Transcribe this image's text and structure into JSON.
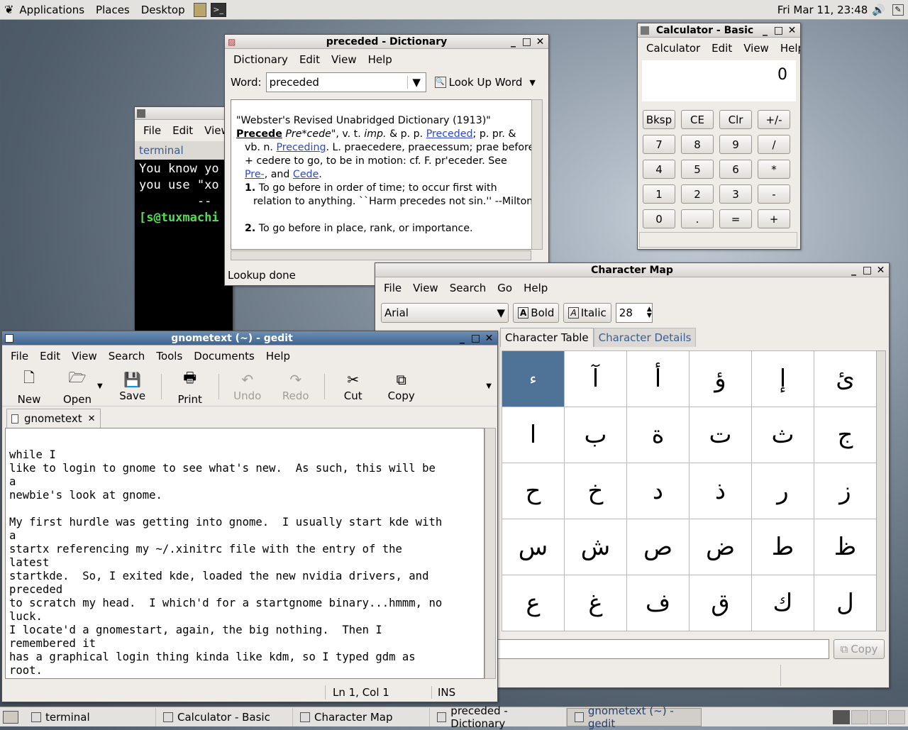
{
  "top_panel": {
    "menus": [
      "Applications",
      "Places",
      "Desktop"
    ],
    "clock": "Fri Mar 11, 23:48"
  },
  "terminal": {
    "menus": [
      "File",
      "Edit",
      "View"
    ],
    "tab": "terminal",
    "lines": [
      "You know yo",
      "you use \"xo",
      "        --"
    ],
    "prompt": "[s@tuxmachi"
  },
  "dictionary": {
    "title": "preceded - Dictionary",
    "menus": [
      "Dictionary",
      "Edit",
      "View",
      "Help"
    ],
    "word_label": "Word:",
    "word_value": "preceded",
    "lookup_label": "Look Up Word",
    "source": "\"Webster's Revised Unabridged Dictionary (1913)\"",
    "headword": "Precede",
    "pron": "Pre*cede\"",
    "def_line1_a": ", v. t.",
    "def_line1_b": "imp.",
    "def_line1_c": "& p. p.",
    "link_preceded": "Preceded",
    "def_line1_d": "; p. pr. &",
    "def_line2_a": "vb. n.",
    "link_preceding": "Preceding",
    "def_line2_b": ". L. praecedere, praecessum; prae before",
    "def_line3": "+ cedere to go, to be in motion: cf. F. pr'eceder. See",
    "link_pre": "Pre-",
    "def_line4_a": ", and",
    "link_cede": "Cede",
    "def_line4_b": ".",
    "sense1_num": "1.",
    "sense1_a": "To go before in order of time; to occur first with",
    "sense1_b": "relation to anything. ``Harm precedes not sin.'' --Milton.",
    "sense2_num": "2.",
    "sense2": "To go before in place, rank, or importance.",
    "status": "Lookup done"
  },
  "calculator": {
    "title": "Calculator - Basic",
    "menus": [
      "Calculator",
      "Edit",
      "View",
      "Help"
    ],
    "display": "0",
    "rows": [
      [
        "Bksp",
        "CE",
        "Clr",
        "+/-"
      ],
      [
        "7",
        "8",
        "9",
        "/"
      ],
      [
        "4",
        "5",
        "6",
        "*"
      ],
      [
        "1",
        "2",
        "3",
        "-"
      ],
      [
        "0",
        ".",
        "=",
        "+"
      ]
    ]
  },
  "charmap": {
    "title": "Character Map",
    "menus": [
      "File",
      "View",
      "Search",
      "Go",
      "Help"
    ],
    "font": "Arial",
    "bold_label": "Bold",
    "italic_label": "Italic",
    "size": "28",
    "tab_table": "Character Table",
    "tab_details": "Character Details",
    "chars": [
      [
        "ء",
        "آ",
        "أ",
        "ؤ",
        "إ",
        "ئ"
      ],
      [
        "ا",
        "ب",
        "ة",
        "ت",
        "ث",
        "ج"
      ],
      [
        "ح",
        "خ",
        "د",
        "ذ",
        "ر",
        "ز"
      ],
      [
        "س",
        "ش",
        "ص",
        "ض",
        "ط",
        "ظ"
      ],
      [
        "ع",
        "غ",
        "ف",
        "ق",
        "ك",
        "ل"
      ]
    ],
    "copy_label": "Copy"
  },
  "gedit": {
    "title": "gnometext (~) - gedit",
    "menus": [
      "File",
      "Edit",
      "View",
      "Search",
      "Tools",
      "Documents",
      "Help"
    ],
    "toolbar": [
      {
        "label": "New",
        "icon": "new-document-icon",
        "enabled": true
      },
      {
        "label": "Open",
        "icon": "open-folder-icon",
        "enabled": true
      },
      {
        "label": "Save",
        "icon": "save-icon",
        "enabled": true
      },
      {
        "label": "Print",
        "icon": "print-icon",
        "enabled": true
      },
      {
        "label": "Undo",
        "icon": "undo-icon",
        "enabled": false
      },
      {
        "label": "Redo",
        "icon": "redo-icon",
        "enabled": false
      },
      {
        "label": "Cut",
        "icon": "cut-icon",
        "enabled": true
      },
      {
        "label": "Copy",
        "icon": "copy-icon",
        "enabled": true
      }
    ],
    "tab": "gnometext",
    "text": "while I\nlike to login to gnome to see what's new.  As such, this will be\na\nnewbie's look at gnome.\n\nMy first hurdle was getting into gnome.  I usually start kde with\na\nstartx referencing my ~/.xinitrc file with the entry of the\nlatest\nstartkde.  So, I exited kde, loaded the new nvidia drivers, and\npreceded\nto scratch my head.  I which'd for a startgnome binary...hmmm, no\nluck.\nI locate'd a gnomestart, again, the big nothing.  Then I\nremembered it\nhas a graphical login thing kinda like kdm, so I typed gdm as\nroot.\nAhhh, there we go.  I logged in and chose gnome as the session.",
    "position": "Ln 1, Col 1",
    "mode": "INS"
  },
  "taskbar": [
    {
      "label": "terminal",
      "active": false
    },
    {
      "label": "Calculator - Basic",
      "active": false
    },
    {
      "label": "Character Map",
      "active": false
    },
    {
      "label": "preceded - Dictionary",
      "active": false
    },
    {
      "label": "gnometext (~) - gedit",
      "active": true
    }
  ]
}
